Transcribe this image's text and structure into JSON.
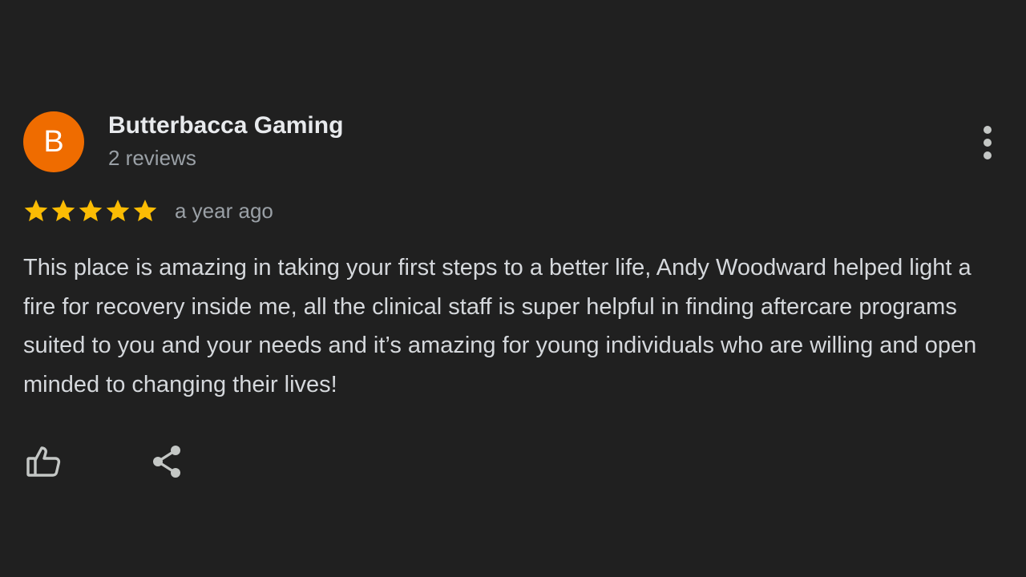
{
  "review": {
    "author": {
      "avatar_initial": "B",
      "name": "Butterbacca Gaming",
      "meta": "2 reviews"
    },
    "rating": {
      "stars": 5,
      "max_stars": 5
    },
    "date": "a year ago",
    "text": "This place is amazing in taking your first steps to a better life, Andy Woodward helped light a fire for recovery inside me, all the clinical staff is super helpful in finding aftercare programs suited to you and your needs and it’s amazing for young individuals who are willing and open minded to changing their lives!"
  },
  "icons": {
    "more": "more-vertical-icon",
    "like": "thumb-up-icon",
    "share": "share-icon",
    "star": "star-icon"
  },
  "colors": {
    "background": "#202020",
    "avatar": "#ef6c00",
    "star": "#fbbc04",
    "name_text": "#e8eaed",
    "secondary_text": "#9aa0a6",
    "body_text": "#d5d8dc",
    "icon": "#c4c7c5"
  }
}
